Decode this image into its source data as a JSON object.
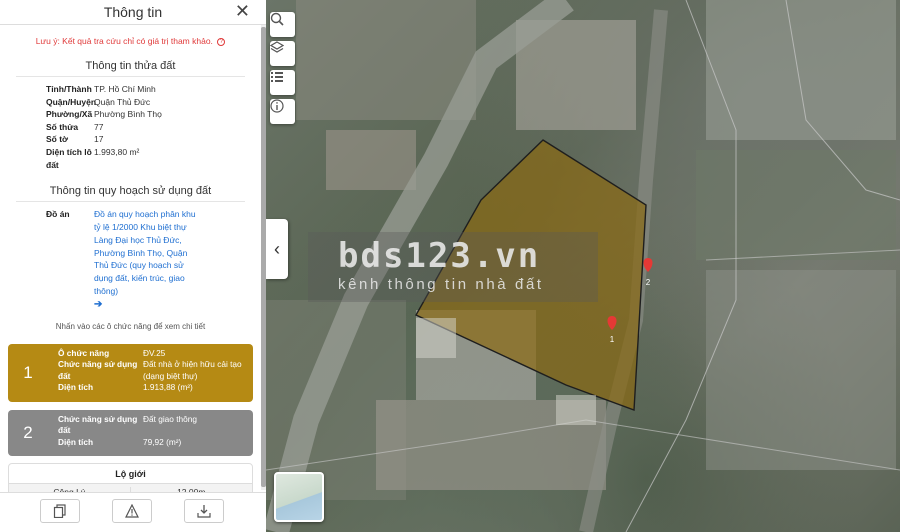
{
  "panel": {
    "title": "Thông tin",
    "close_label": "✕",
    "note": "Lưu ý: Kết quả tra cứu chỉ có giá trị tham khảo.",
    "parcel_section_title": "Thông tin thửa đất",
    "parcel": [
      {
        "label": "Tỉnh/Thành",
        "value": "TP. Hồ Chí Minh"
      },
      {
        "label": "Quận/Huyện",
        "value": "Quận Thủ Đức"
      },
      {
        "label": "Phường/Xã",
        "value": "Phường Bình Thọ"
      },
      {
        "label": "Số thửa",
        "value": "77"
      },
      {
        "label": "Số tờ",
        "value": "17"
      },
      {
        "label": "Diện tích lô đất",
        "value": "1.993,80 m²"
      }
    ],
    "planning_section_title": "Thông tin quy hoạch sử dụng đất",
    "doan_label": "Đồ án",
    "doan_value": "Đồ án quy hoạch phân khu tỷ lệ 1/2000 Khu biệt thự Làng Đại học Thủ Đức, Phường Bình Thọ, Quận Thủ Đức (quy hoạch sử dụng đất, kiến trúc, giao thông)",
    "hint": "Nhấn vào các ô chức năng để xem chi tiết",
    "functions": [
      {
        "number": "1",
        "color": "#b58a14",
        "rows": [
          {
            "label": "Ô chức năng",
            "value": "ĐV.25"
          },
          {
            "label": "Chức năng sử dụng đất",
            "value": "Đất nhà ở hiện hữu cải tạo (dạng biệt thự)"
          },
          {
            "label": "Diện tích",
            "value": "1.913,88 (m²)"
          }
        ]
      },
      {
        "number": "2",
        "color": "#888888",
        "rows": [
          {
            "label": "Chức năng sử dụng đất",
            "value": "Đất giao thông"
          },
          {
            "label": "Diện tích",
            "value": "79,92 (m²)"
          }
        ]
      }
    ],
    "logioi": {
      "title": "Lộ giới",
      "rows": [
        {
          "street": "Công Lý",
          "width": "12,00m"
        }
      ]
    }
  },
  "map": {
    "watermark_title": "bds123.vn",
    "watermark_subtitle": "kênh thông tin nhà đất",
    "markers": [
      "1",
      "2"
    ],
    "marker_color": "#e53935",
    "parcel_fill": "#8a6a12",
    "tools": [
      "search-icon",
      "layers-icon",
      "list-icon",
      "info-icon"
    ]
  }
}
